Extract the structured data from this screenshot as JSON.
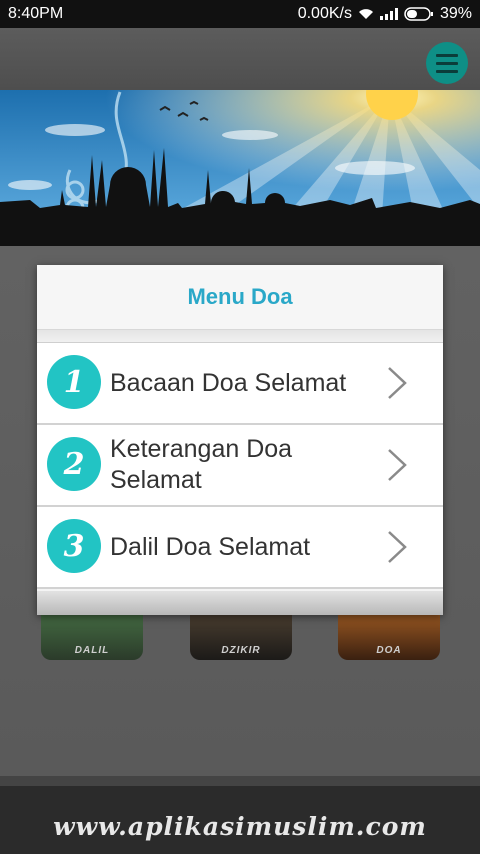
{
  "status": {
    "time": "8:40PM",
    "net_speed": "0.00K/s",
    "battery_percent": "39%",
    "icons": [
      "wifi-icon",
      "signal-icon",
      "battery-icon"
    ]
  },
  "appbar": {
    "menu_icon": "hamburger-menu-icon",
    "accent": "#0e8f86"
  },
  "dialog": {
    "title": "Menu Doa",
    "title_color": "#2aa8c8",
    "items": [
      {
        "number": "1",
        "label": "Bacaan Doa Selamat"
      },
      {
        "number": "2",
        "label": "Keterangan Doa Selamat"
      },
      {
        "number": "3",
        "label": "Dalil Doa Selamat"
      }
    ]
  },
  "tiles": [
    {
      "label": "DALIL"
    },
    {
      "label": "DZIKIR"
    },
    {
      "label": "DOA"
    }
  ],
  "footer": {
    "url": "www.aplikasimuslim.com"
  }
}
